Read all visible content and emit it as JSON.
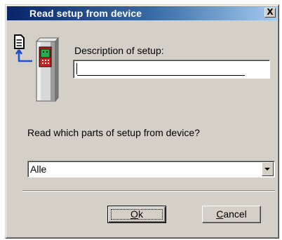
{
  "dialog": {
    "title": "Read setup from device",
    "close_label": "X"
  },
  "description": {
    "label": "Description of setup:",
    "value": ""
  },
  "parts": {
    "label": "Read which parts of setup from device?",
    "selected": "Alle"
  },
  "buttons": {
    "ok_first": "O",
    "ok_rest": "k",
    "cancel_first": "C",
    "cancel_rest": "ancel"
  },
  "icons": {
    "device": "read-from-device-icon",
    "close": "close-icon",
    "dropdown": "chevron-down-icon"
  },
  "colors": {
    "titlebar_start": "#0a246a",
    "titlebar_end": "#a6caf0",
    "dialog_face": "#d4d0c8",
    "device_red": "#d81c1c",
    "device_green": "#22b14c",
    "arrow_blue": "#1f4fd1"
  }
}
